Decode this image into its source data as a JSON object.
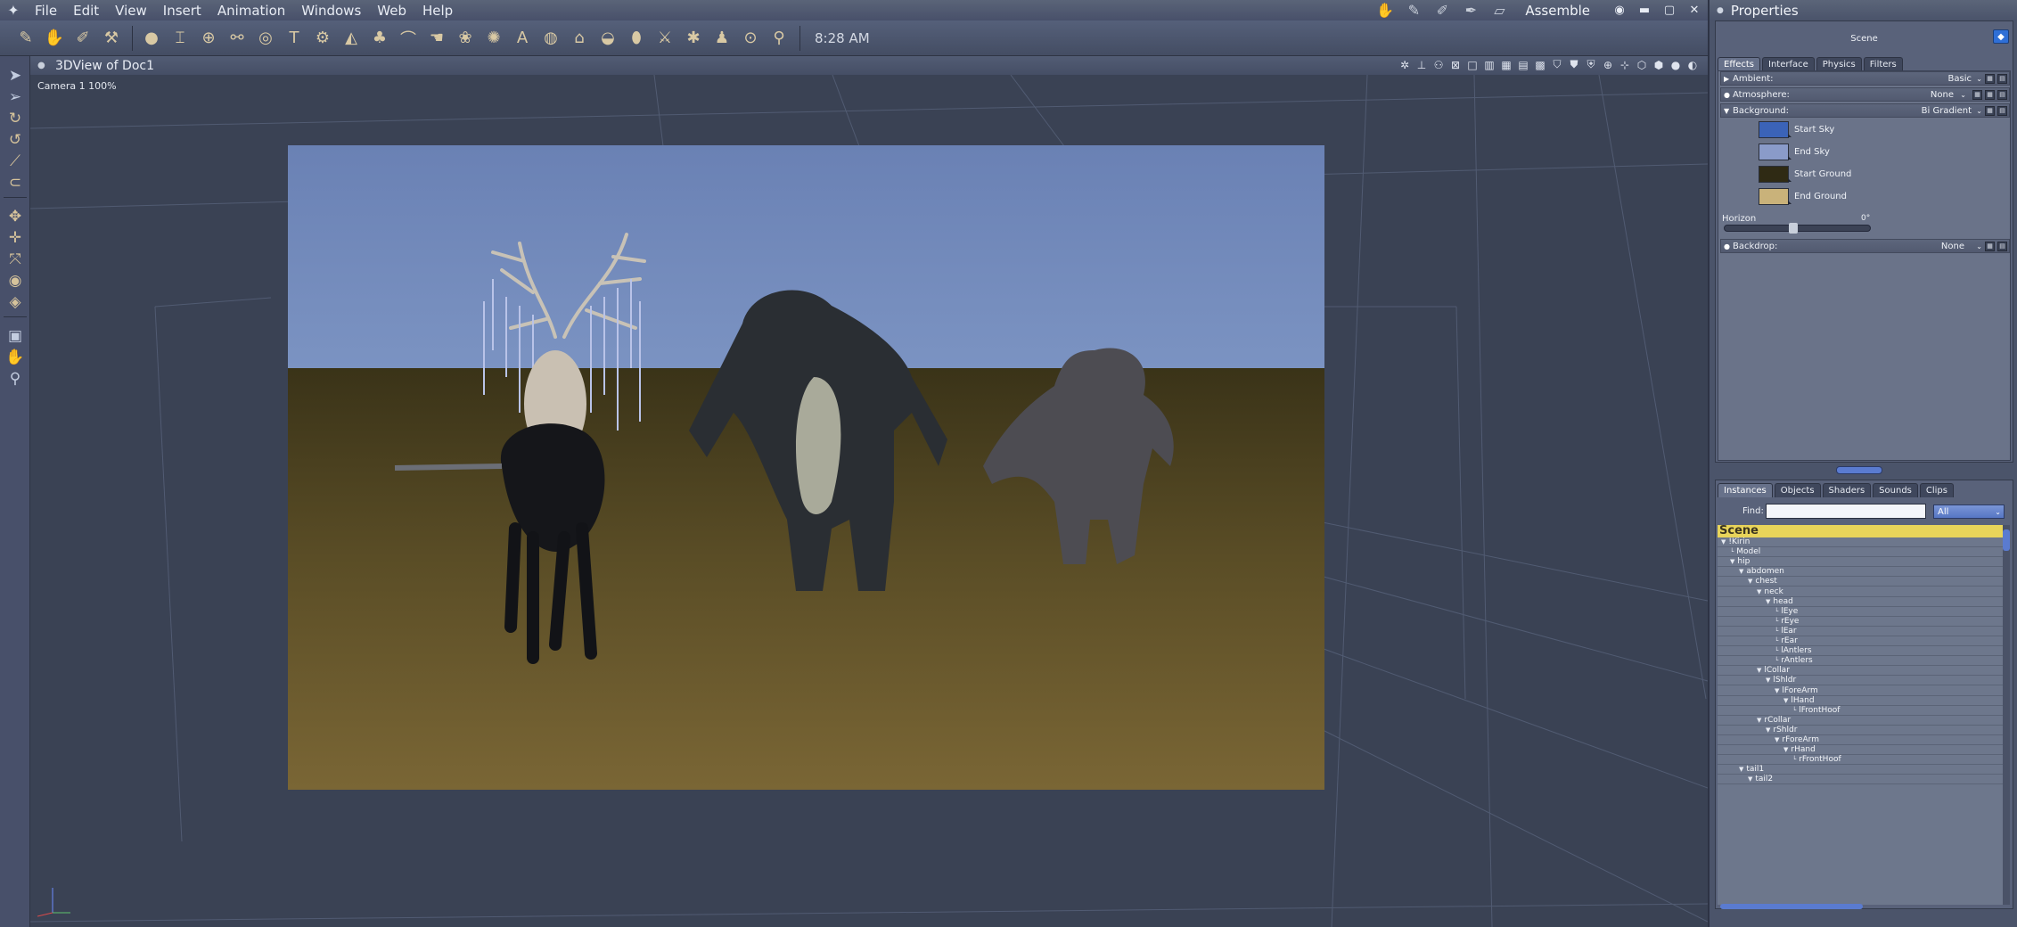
{
  "menubar": {
    "items": [
      "File",
      "Edit",
      "View",
      "Insert",
      "Animation",
      "Windows",
      "Web",
      "Help"
    ],
    "room_label": "Assemble"
  },
  "toolbar": {
    "clock": "8:28 AM"
  },
  "viewport": {
    "title": "3DView of Doc1",
    "camera_label": "Camera 1 100%"
  },
  "properties": {
    "title": "Properties",
    "scene_label": "Scene",
    "tabs": [
      "Effects",
      "Interface",
      "Physics",
      "Filters"
    ],
    "active_tab": "Effects",
    "ambient": {
      "label": "Ambient:",
      "value": "Basic"
    },
    "atmosphere": {
      "label": "Atmosphere:",
      "value": "None"
    },
    "background": {
      "label": "Background:",
      "value": "Bi Gradient"
    },
    "swatches": [
      {
        "label": "Start Sky",
        "color": "#3b63b8"
      },
      {
        "label": "End Sky",
        "color": "#8a9bc9"
      },
      {
        "label": "Start Ground",
        "color": "#2f2a14"
      },
      {
        "label": "End Ground",
        "color": "#c9b27a"
      }
    ],
    "horizon": {
      "label": "Horizon",
      "value": "0°"
    },
    "backdrop": {
      "label": "Backdrop:",
      "value": "None"
    }
  },
  "library": {
    "tabs": [
      "Instances",
      "Objects",
      "Shaders",
      "Sounds",
      "Clips"
    ],
    "active_tab": "Instances",
    "find_label": "Find:",
    "find_value": "",
    "filter_value": "All",
    "tree_root": "Scene",
    "tree": [
      {
        "label": "!Kirin",
        "depth": 0,
        "twisty": true
      },
      {
        "label": "Model",
        "depth": 1,
        "twisty": false
      },
      {
        "label": "hip",
        "depth": 1,
        "twisty": true
      },
      {
        "label": "abdomen",
        "depth": 2,
        "twisty": true
      },
      {
        "label": "chest",
        "depth": 3,
        "twisty": true
      },
      {
        "label": "neck",
        "depth": 4,
        "twisty": true
      },
      {
        "label": "head",
        "depth": 5,
        "twisty": true
      },
      {
        "label": "lEye",
        "depth": 6,
        "twisty": false
      },
      {
        "label": "rEye",
        "depth": 6,
        "twisty": false
      },
      {
        "label": "lEar",
        "depth": 6,
        "twisty": false
      },
      {
        "label": "rEar",
        "depth": 6,
        "twisty": false
      },
      {
        "label": "lAntlers",
        "depth": 6,
        "twisty": false
      },
      {
        "label": "rAntlers",
        "depth": 6,
        "twisty": false
      },
      {
        "label": "lCollar",
        "depth": 4,
        "twisty": true
      },
      {
        "label": "lShldr",
        "depth": 5,
        "twisty": true
      },
      {
        "label": "lForeArm",
        "depth": 6,
        "twisty": true
      },
      {
        "label": "lHand",
        "depth": 7,
        "twisty": true
      },
      {
        "label": "lFrontHoof",
        "depth": 8,
        "twisty": false
      },
      {
        "label": "rCollar",
        "depth": 4,
        "twisty": true
      },
      {
        "label": "rShldr",
        "depth": 5,
        "twisty": true
      },
      {
        "label": "rForeArm",
        "depth": 6,
        "twisty": true
      },
      {
        "label": "rHand",
        "depth": 7,
        "twisty": true
      },
      {
        "label": "rFrontHoof",
        "depth": 8,
        "twisty": false
      },
      {
        "label": "tail1",
        "depth": 2,
        "twisty": true
      },
      {
        "label": "tail2",
        "depth": 3,
        "twisty": true
      }
    ]
  }
}
